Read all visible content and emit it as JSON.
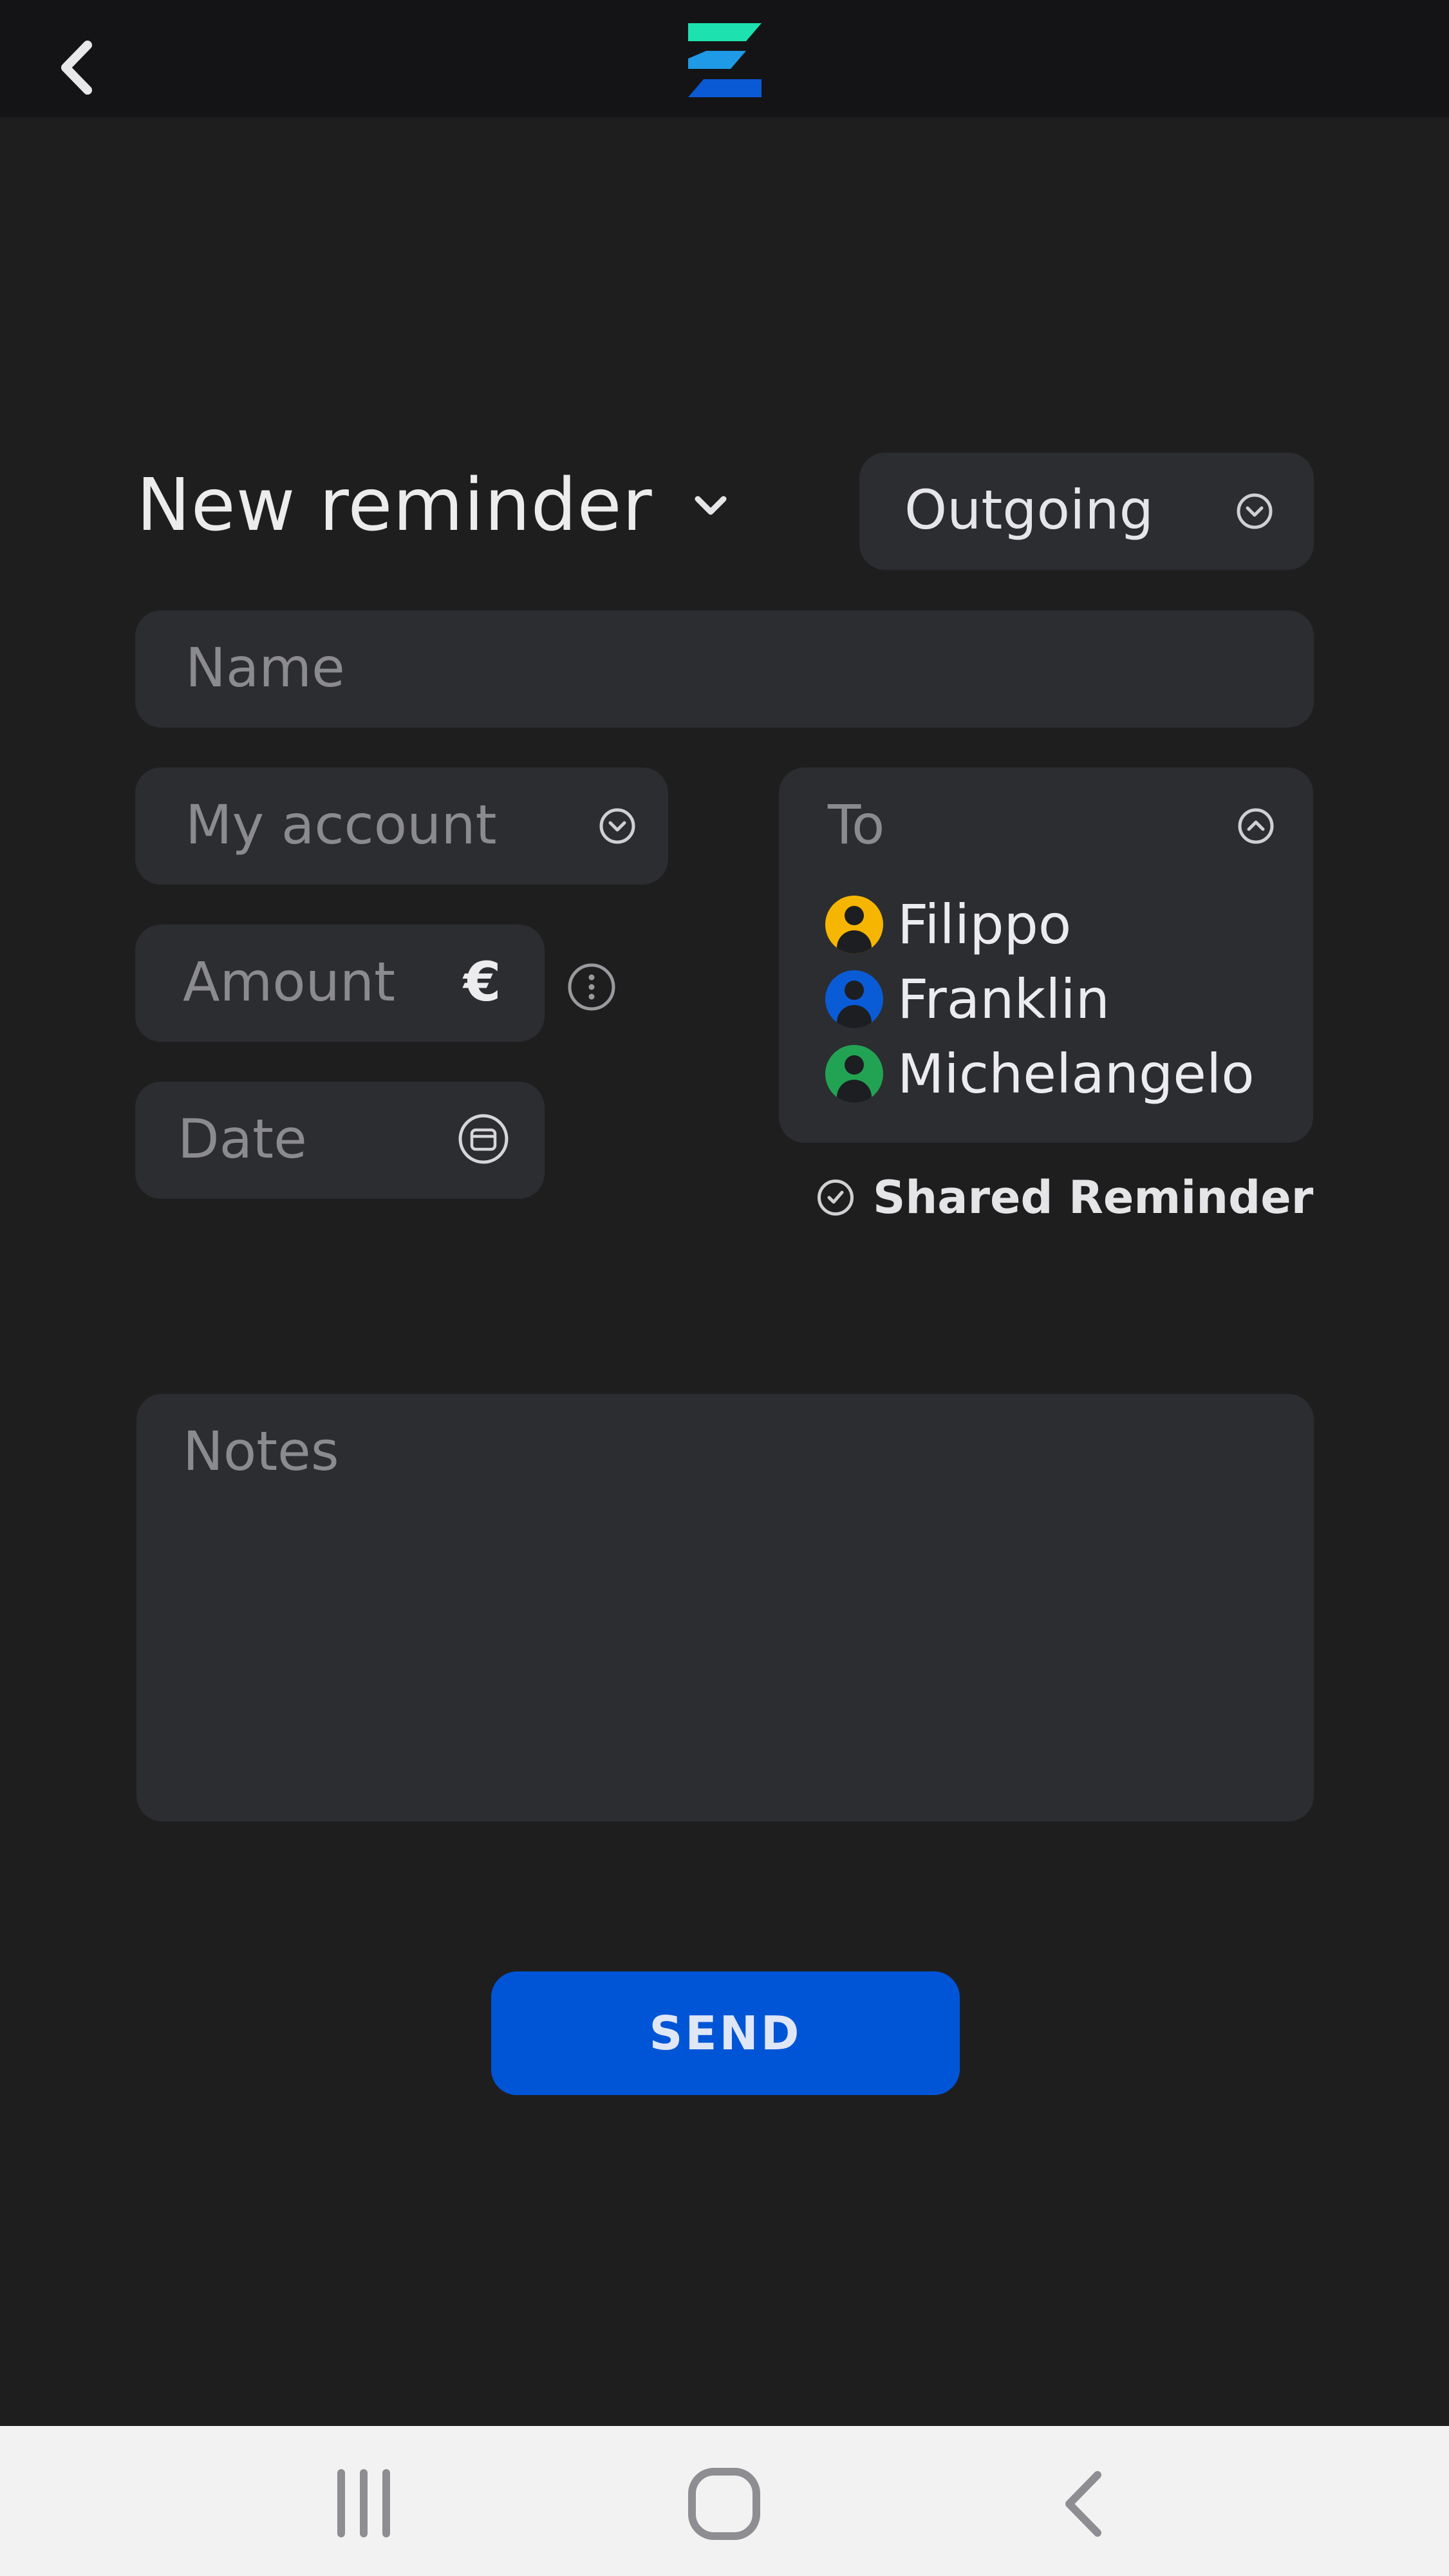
{
  "header": {
    "back_icon": "chevron-left-icon",
    "logo_icon": "app-logo-icon",
    "colors": {
      "logo_top": "#1de2b0",
      "logo_mid": "#1f9ae6",
      "logo_bottom": "#0a5ad6"
    }
  },
  "form": {
    "title": "New reminder",
    "direction": {
      "value": "Outgoing",
      "icon": "chevron-down-circle-icon"
    },
    "name_placeholder": "Name",
    "account_placeholder": "My account",
    "amount_placeholder": "Amount",
    "currency_symbol": "€",
    "date_placeholder": "Date",
    "to_placeholder": "To",
    "recipients": [
      {
        "name": "Filippo",
        "color": "#f6b500"
      },
      {
        "name": "Franklin",
        "color": "#0a5bd6"
      },
      {
        "name": "Michelangelo",
        "color": "#22a353"
      }
    ],
    "shared_label": "Shared Reminder",
    "notes_placeholder": "Notes",
    "send_label": "SEND"
  },
  "colors": {
    "accent": "#0055d7",
    "background": "#1e1e1f",
    "field": "#2c2d31"
  },
  "system_nav": {
    "items": [
      "recent-apps-icon",
      "home-icon",
      "back-icon"
    ]
  }
}
